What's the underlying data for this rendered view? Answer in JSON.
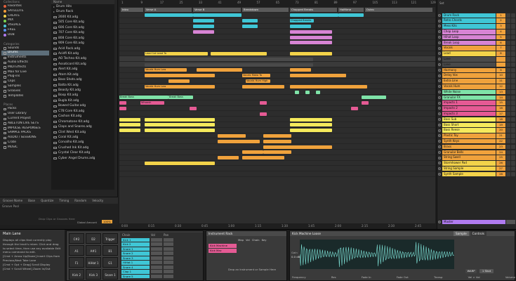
{
  "browser": {
    "collections_header": "Collections",
    "collections": [
      {
        "label": "Favorites",
        "color": "#e35f3c"
      },
      {
        "label": "SATELLITE",
        "color": "#f39c39"
      },
      {
        "label": "CREATE",
        "color": "#f3d34a"
      },
      {
        "label": "MIX",
        "color": "#7bd34e"
      },
      {
        "label": "VISUALS",
        "color": "#4fc7d8"
      },
      {
        "label": "FREE",
        "color": "#5a8ff0"
      },
      {
        "label": "DUB",
        "color": "#b07bf0"
      }
    ],
    "categories_header": "Categories",
    "categories": [
      "Sounds",
      "Drums",
      "Instruments",
      "Audio Effects",
      "MIDI Effects",
      "Max for Live",
      "Plug-ins",
      "Clips",
      "Samples",
      "Grooves",
      "Templates"
    ],
    "places_header": "Places",
    "places": [
      "Packs",
      "User Library",
      "Current Project",
      "ABLETON LIVE SETS",
      "IMPULSE RESPONSES",
      "SAMPLE PACKS",
      "AUDIO / SESSIONS",
      "Crate",
      "MUSIC"
    ],
    "name_header": "Name",
    "files": [
      "Drum Hits",
      "Drum Rack",
      "2600 Kit.adg",
      "505 Core Kit.adg",
      "606 Core Kit.adg",
      "707 Core Kit.adg",
      "808 Core Kit.adg",
      "909 Core Kit.adg",
      "Acid Rack.adg",
      "Acidfi Kit.adg",
      "AO Techno Kit.adg",
      "Assoticord Kit.adg",
      "Alert Kit.adg",
      "Atom Kit.adg",
      "Bass Shots.adg",
      "Batta Kit.adg",
      "Beasty Kit.adg",
      "Boop Kit.adg",
      "Bugla Kit.adg",
      "Bowed Guitar.adg",
      "C78 Core Kit.adg",
      "Cashon Kit.adg",
      "Chromatone Kit.adg",
      "Claps and Snares.adg",
      "Clint West Kit.adg",
      "Coral Kit.adg",
      "Corvalho Kit.adg",
      "Crushed Ink Kit.adg",
      "Crystal Clear Kit.adg",
      "Cyber Angel Drums.adg"
    ]
  },
  "grooves": {
    "headers": [
      "Groove Name",
      "Base",
      "Quantize",
      "Timing",
      "Random",
      "Velocity"
    ],
    "pool_label": "Groove Pool",
    "drop_hint": "Drop Clips or Grooves Here",
    "global_amount_label": "Global Amount",
    "global_amount": "100%"
  },
  "arrangement": {
    "ruler": [
      "1",
      "9",
      "17",
      "25",
      "33",
      "41",
      "49",
      "57",
      "65",
      "73",
      "81",
      "89",
      "97",
      "105",
      "113",
      "121",
      "129"
    ],
    "time": [
      "0:00",
      "0:15",
      "0:30",
      "0:45",
      "1:00",
      "1:15",
      "1:30",
      "1:45",
      "2:00",
      "2:15",
      "2:30",
      "2:45"
    ],
    "locators": [
      {
        "label": "Intro",
        "color": "#5a5a5a"
      },
      {
        "label": "Verse A",
        "color": "#5a5a5a"
      },
      {
        "label": "Verse B",
        "color": "#5a5a5a"
      },
      {
        "label": "Breakdown",
        "color": "#5a5a5a"
      },
      {
        "label": "Chopped Breaks",
        "color": "#5a5a5a"
      },
      {
        "label": "Halftime",
        "color": "#5a5a5a"
      },
      {
        "label": "Outro",
        "color": "#5a5a5a"
      }
    ],
    "clip_names": [
      "Chopped Breaks",
      "Lead 1st Lead Ta",
      "Vocals Hum Low",
      "Vocals Hum High",
      "Vocals Mako Ta",
      "Break Bass",
      "Whoosh",
      "Break Bass",
      "Vocals Hum Low"
    ]
  },
  "mixer": {
    "set_label": "Set",
    "tracks": [
      {
        "name": "Drum Rack",
        "color": "#3fc6d6",
        "num": "1"
      },
      {
        "name": "Retro Chords",
        "color": "#3fc6d6",
        "num": "2"
      },
      {
        "name": "Mess Kits",
        "color": "#3fc6d6",
        "num": "3"
      },
      {
        "name": "Chop Loop",
        "color": "#d784d4",
        "num": "4"
      },
      {
        "name": "Hihat Loop",
        "color": "#d784d4",
        "num": "5"
      },
      {
        "name": "Break Loop",
        "color": "#d784d4",
        "num": "6"
      },
      {
        "name": "Vocals",
        "color": "#f0a23c",
        "num": "7"
      },
      {
        "name": "Lead",
        "color": "#f3d34a",
        "num": "8"
      },
      {
        "name": "Lane",
        "color": "#4a4a4a",
        "num": ""
      },
      {
        "name": "Lane",
        "color": "#4a4a4a",
        "num": ""
      },
      {
        "name": "Harmony",
        "color": "#f0a23c",
        "num": "9"
      },
      {
        "name": "Delay Vox",
        "color": "#f0a23c",
        "num": "10"
      },
      {
        "name": "Extra Line",
        "color": "#f0a23c",
        "num": "11"
      },
      {
        "name": "Vocals Hum",
        "color": "#f0a23c",
        "num": "12"
      },
      {
        "name": "White Noise",
        "color": "#7fe3a8",
        "num": "13"
      },
      {
        "name": "Granular FX",
        "color": "#7fe3a8",
        "num": "14"
      },
      {
        "name": "Impacts 1",
        "color": "#e55a94",
        "num": "15"
      },
      {
        "name": "Impacts 2",
        "color": "#e55a94",
        "num": "16"
      },
      {
        "name": "Impacts 3",
        "color": "#e55a94",
        "num": "17"
      },
      {
        "name": "Bass Sub",
        "color": "#f6ea5c",
        "num": "18"
      },
      {
        "name": "Bass Short",
        "color": "#f6ea5c",
        "num": "19"
      },
      {
        "name": "Bass Reese",
        "color": "#f6ea5c",
        "num": "20"
      },
      {
        "name": "Plastic Toy",
        "color": "#f0a23c",
        "num": "21"
      },
      {
        "name": "Synth Keys",
        "color": "#f0a23c",
        "num": "22"
      },
      {
        "name": "Brass",
        "color": "#f0a23c",
        "num": "23"
      },
      {
        "name": "Granular Bells",
        "color": "#f0a23c",
        "num": "24"
      },
      {
        "name": "String Swell",
        "color": "#f0a23c",
        "num": "25"
      },
      {
        "name": "Stormhower Pad",
        "color": "#f3d34a",
        "num": "26"
      },
      {
        "name": "String Sample",
        "color": "#f3d34a",
        "num": "27"
      },
      {
        "name": "Synth Sample",
        "color": "#f3d34a",
        "num": "28"
      }
    ],
    "master_label": "Master"
  },
  "info": {
    "title": "Main Lane",
    "body": [
      "Displays all clips that currently play",
      "through the track's mixer. Click and drag",
      "to select time, then use any available Edit",
      "menu command to edit.",
      "[Cmd + Arrow Up/Down] Insert Clips from",
      "Previous/Next Take Lane",
      "[Cmd + Opt + Drag] Scroll Display",
      "[Cmd + Scroll Wheel] Zoom In/Out"
    ]
  },
  "drum_rack": {
    "pads": [
      {
        "note": "C#2",
        "sub": ""
      },
      {
        "note": "D2",
        "sub": ""
      },
      {
        "note": "Trigger Signal",
        "sub": ""
      },
      {
        "note": "A1",
        "sub": ""
      },
      {
        "note": "A#1",
        "sub": ""
      },
      {
        "note": "B1",
        "sub": ""
      },
      {
        "note": "F1",
        "sub": ""
      },
      {
        "note": "HiHat 1",
        "sub": ""
      },
      {
        "note": "G1",
        "sub": ""
      },
      {
        "note": "Kick 2",
        "sub": ""
      },
      {
        "note": "Kick 3",
        "sub": ""
      },
      {
        "note": "Snare 1",
        "sub": ""
      }
    ],
    "chain_header": "Chain",
    "vol_header": "Vol",
    "pan_header": "Pan",
    "chains": [
      "Kick 1",
      "Kick 2",
      "Snare 1",
      "Snare 2",
      "Snare 3",
      "HiHat 1",
      "Snare 4",
      "Clap 1",
      "Snare 5"
    ]
  },
  "instrument_rack": {
    "title": "Instrument Rack",
    "macros": [
      "Map",
      "Vel",
      "Chain",
      "Key"
    ],
    "chains": [
      "Kick Machine",
      "Kick Mac"
    ],
    "drop_hint": "Drop an Instrument or Sample Here"
  },
  "simpler": {
    "title": "Kick Machine Loose",
    "tabs": [
      "Sample",
      "Controls"
    ],
    "params": [
      "Gain",
      "Frequency",
      "Res",
      "Fade In",
      "Fade Out",
      "Transp",
      "Vel > Vol",
      "Volume"
    ],
    "gain_value": "0.0 dB",
    "mode": "1 Shot",
    "start_label": "Start",
    "warp_label": "WARP"
  }
}
